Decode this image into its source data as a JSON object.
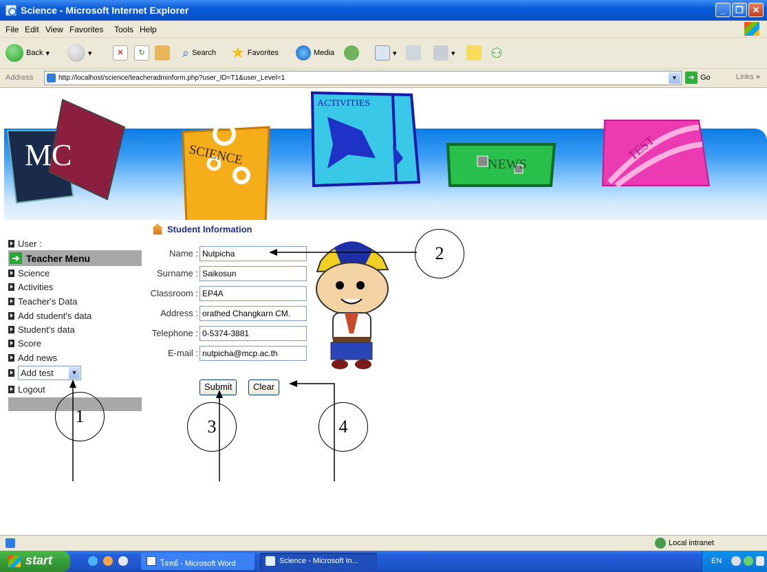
{
  "window": {
    "title": "Science - Microsoft Internet Explorer"
  },
  "menu": [
    "File",
    "Edit",
    "View",
    "Favorites",
    "Tools",
    "Help"
  ],
  "toolbar": {
    "back": "Back",
    "search": "Search",
    "favorites": "Favorites",
    "media": "Media"
  },
  "address": {
    "label": "Address",
    "url": "http://localhost/science/teacheradminform.php?user_ID=T1&user_Level=1",
    "go": "Go",
    "links": "Links"
  },
  "banner": {
    "science": "SCIENCE",
    "activities": "ACTIVITIES",
    "news": "NEWS",
    "test": "TEST",
    "logo": "MC"
  },
  "sidebar": {
    "user": "User :",
    "teacher_menu": "Teacher Menu",
    "items": [
      "Science",
      "Activities",
      "Teacher's Data",
      "Add student's data",
      "Student's data",
      "Score",
      "Add news"
    ],
    "add_test": "Add test",
    "logout": "Logout"
  },
  "form": {
    "title": "Student Information",
    "fields": [
      {
        "label": "Name :",
        "value": "Nutpicha"
      },
      {
        "label": "Surname :",
        "value": "Saikosun"
      },
      {
        "label": "Classroom :",
        "value": "EP4A"
      },
      {
        "label": "Address :",
        "value": "orathed Changkarn CM."
      },
      {
        "label": "Telephone :",
        "value": "0-5374-3881"
      },
      {
        "label": "E-mail :",
        "value": "nutpicha@mcp.ac.th"
      }
    ],
    "submit": "Submit",
    "clear": "Clear"
  },
  "callouts": [
    "1",
    "2",
    "3",
    "4"
  ],
  "status": {
    "zone": "Local intranet"
  },
  "taskbar": {
    "start": "start",
    "tasks": [
      "โจทย์ - Microsoft Word",
      "Science - Microsoft In..."
    ],
    "lang": "EN"
  }
}
